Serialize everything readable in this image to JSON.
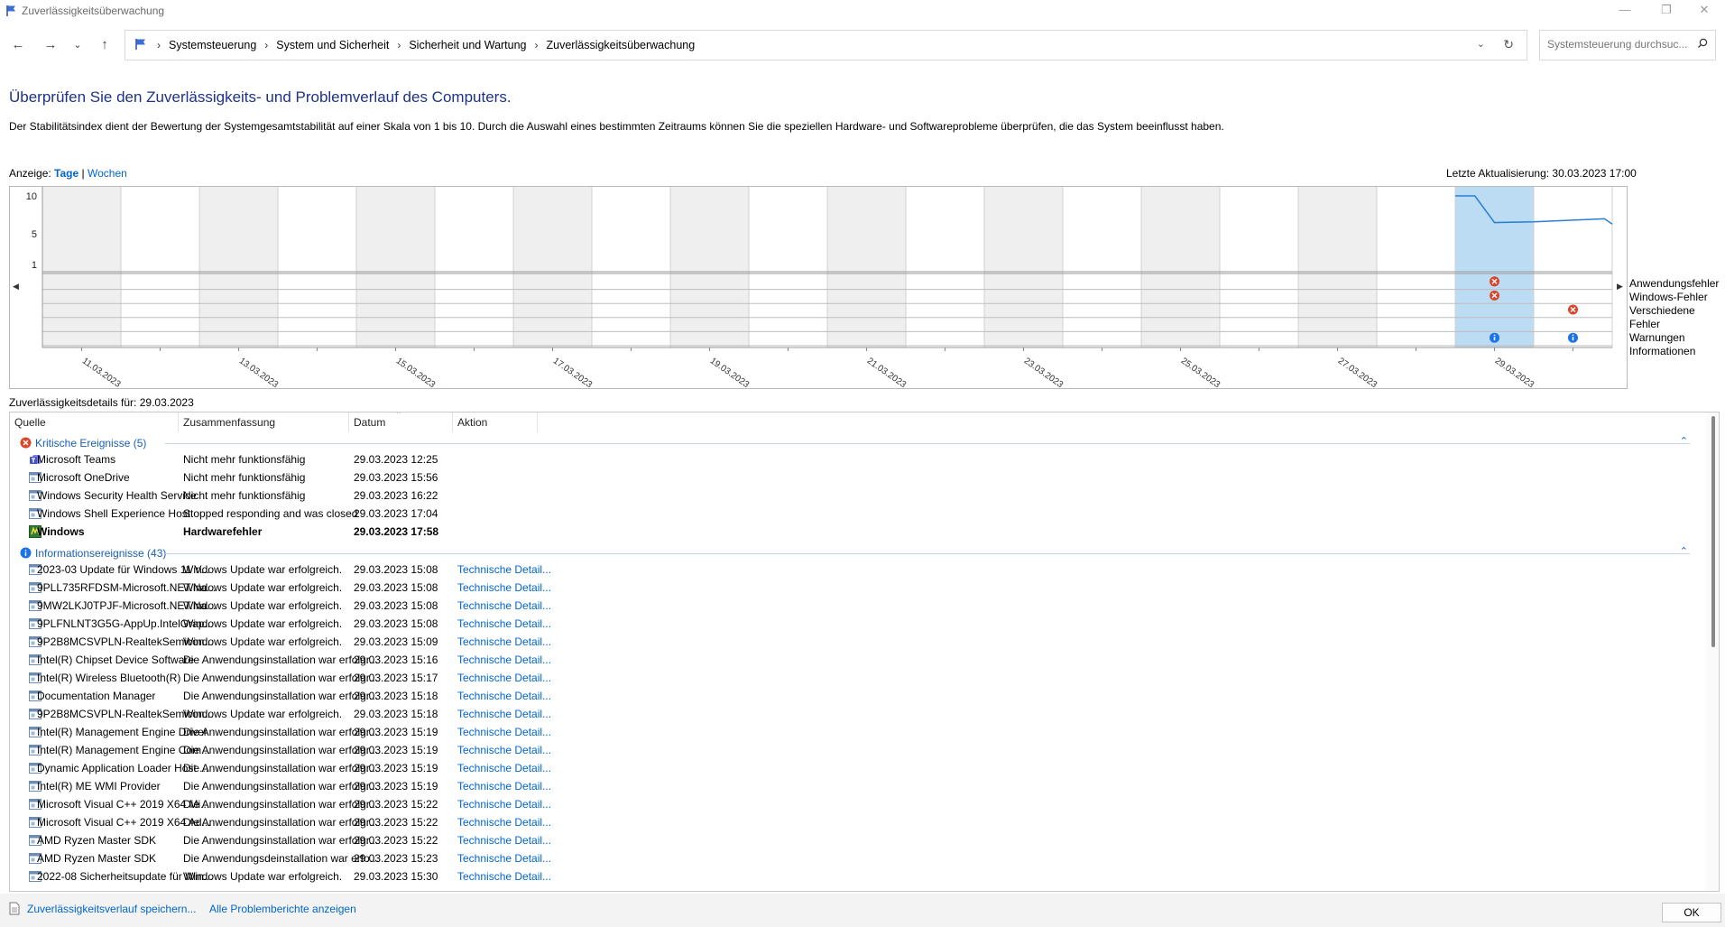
{
  "window": {
    "title": "Zuverlässigkeitsüberwachung"
  },
  "breadcrumbs": [
    "Systemsteuerung",
    "System und Sicherheit",
    "Sicherheit und Wartung",
    "Zuverlässigkeitsüberwachung"
  ],
  "search": {
    "placeholder": "Systemsteuerung durchsuc..."
  },
  "heading": "Überprüfen Sie den Zuverlässigkeits- und Problemverlauf des Computers.",
  "description": "Der Stabilitätsindex dient der Bewertung der Systemgesamtstabilität auf einer Skala von 1 bis 10. Durch die Auswahl eines bestimmten Zeitraums können Sie die speziellen Hardware- und Softwareprobleme überprüfen, die das System beeinflusst haben.",
  "view": {
    "label": "Anzeige:",
    "days": "Tage",
    "sep": "|",
    "weeks": "Wochen"
  },
  "last_update": "Letzte Aktualisierung: 30.03.2023 17:00",
  "chart_data": {
    "type": "line",
    "title": "",
    "yticks": [
      "10",
      "5",
      "1"
    ],
    "ylim": [
      1,
      10
    ],
    "x_labels": [
      "11.03.2023",
      "13.03.2023",
      "15.03.2023",
      "17.03.2023",
      "19.03.2023",
      "21.03.2023",
      "23.03.2023",
      "25.03.2023",
      "27.03.2023",
      "29.03.2023"
    ],
    "columns": 20,
    "selected_column": 18,
    "series": [
      {
        "points": [
          [
            18.0,
            10.0
          ],
          [
            18.25,
            10.0
          ],
          [
            18.5,
            6.5
          ],
          [
            19.0,
            6.6
          ],
          [
            19.9,
            7.0
          ],
          [
            20.0,
            6.3
          ]
        ]
      }
    ],
    "legend": [
      "Anwendungsfehler",
      "Windows-Fehler",
      "Verschiedene Fehler",
      "Warnungen",
      "Informationen"
    ],
    "events": [
      {
        "column": 18,
        "type": "Anwendungsfehler",
        "icon": "error"
      },
      {
        "column": 18,
        "type": "Windows-Fehler",
        "icon": "error"
      },
      {
        "column": 19,
        "type": "Verschiedene Fehler",
        "icon": "error"
      },
      {
        "column": 18,
        "type": "Informationen",
        "icon": "info"
      },
      {
        "column": 19,
        "type": "Informationen",
        "icon": "info"
      }
    ]
  },
  "details_label": "Zuverlässigkeitsdetails für: 29.03.2023",
  "columns": {
    "source": "Quelle",
    "summary": "Zusammenfassung",
    "date": "Datum",
    "action": "Aktion"
  },
  "groups": [
    {
      "title": "Kritische Ereignisse (5)",
      "icon": "error-icon",
      "rows": [
        {
          "source": "Microsoft Teams",
          "summary": "Nicht mehr funktionsfähig",
          "date": "29.03.2023 12:25",
          "action": "",
          "icon": "teams-icon"
        },
        {
          "source": "Microsoft OneDrive",
          "summary": "Nicht mehr funktionsfähig",
          "date": "29.03.2023 15:56",
          "action": "",
          "icon": "app-icon"
        },
        {
          "source": "Windows Security Health Service",
          "summary": "Nicht mehr funktionsfähig",
          "date": "29.03.2023 16:22",
          "action": "",
          "icon": "app-icon"
        },
        {
          "source": "Windows Shell Experience Host",
          "summary": "Stopped responding and was closed",
          "date": "29.03.2023 17:04",
          "action": "",
          "icon": "app-icon"
        },
        {
          "source": "Windows",
          "summary": "Hardwarefehler",
          "date": "29.03.2023 17:58",
          "action": "",
          "icon": "windows-icon",
          "bold": true
        }
      ]
    },
    {
      "title": "Informationsereignisse (43)",
      "icon": "info-icon",
      "rows": [
        {
          "source": "2023-03 Update für Windows 11 V...",
          "summary": "Windows Update war erfolgreich.",
          "date": "29.03.2023 15:08",
          "action": "Technische Detail..."
        },
        {
          "source": "9PLL735RFDSM-Microsoft.NET.Na...",
          "summary": "Windows Update war erfolgreich.",
          "date": "29.03.2023 15:08",
          "action": "Technische Detail..."
        },
        {
          "source": "9MW2LKJ0TPJF-Microsoft.NET.Na...",
          "summary": "Windows Update war erfolgreich.",
          "date": "29.03.2023 15:08",
          "action": "Technische Detail..."
        },
        {
          "source": "9PLFNLNT3G5G-AppUp.IntelGrap...",
          "summary": "Windows Update war erfolgreich.",
          "date": "29.03.2023 15:08",
          "action": "Technische Detail..."
        },
        {
          "source": "9P2B8MCSVPLN-RealtekSemicon...",
          "summary": "Windows Update war erfolgreich.",
          "date": "29.03.2023 15:09",
          "action": "Technische Detail..."
        },
        {
          "source": "Intel(R) Chipset Device Software",
          "summary": "Die Anwendungsinstallation war erfolgr...",
          "date": "29.03.2023 15:16",
          "action": "Technische Detail..."
        },
        {
          "source": "Intel(R) Wireless Bluetooth(R)",
          "summary": "Die Anwendungsinstallation war erfolgr...",
          "date": "29.03.2023 15:17",
          "action": "Technische Detail..."
        },
        {
          "source": "Documentation Manager",
          "summary": "Die Anwendungsinstallation war erfolgr...",
          "date": "29.03.2023 15:18",
          "action": "Technische Detail..."
        },
        {
          "source": "9P2B8MCSVPLN-RealtekSemicon...",
          "summary": "Windows Update war erfolgreich.",
          "date": "29.03.2023 15:18",
          "action": "Technische Detail..."
        },
        {
          "source": "Intel(R) Management Engine Driver",
          "summary": "Die Anwendungsinstallation war erfolgr...",
          "date": "29.03.2023 15:19",
          "action": "Technische Detail..."
        },
        {
          "source": "Intel(R) Management Engine Com...",
          "summary": "Die Anwendungsinstallation war erfolgr...",
          "date": "29.03.2023 15:19",
          "action": "Technische Detail..."
        },
        {
          "source": "Dynamic Application Loader Host ...",
          "summary": "Die Anwendungsinstallation war erfolgr...",
          "date": "29.03.2023 15:19",
          "action": "Technische Detail..."
        },
        {
          "source": "Intel(R) ME WMI Provider",
          "summary": "Die Anwendungsinstallation war erfolgr...",
          "date": "29.03.2023 15:19",
          "action": "Technische Detail..."
        },
        {
          "source": "Microsoft Visual C++ 2019 X64 Mi...",
          "summary": "Die Anwendungsinstallation war erfolgr...",
          "date": "29.03.2023 15:22",
          "action": "Technische Detail..."
        },
        {
          "source": "Microsoft Visual C++ 2019 X64 Ad...",
          "summary": "Die Anwendungsinstallation war erfolgr...",
          "date": "29.03.2023 15:22",
          "action": "Technische Detail..."
        },
        {
          "source": "AMD Ryzen Master SDK",
          "summary": "Die Anwendungsinstallation war erfolgr...",
          "date": "29.03.2023 15:22",
          "action": "Technische Detail..."
        },
        {
          "source": "AMD Ryzen Master SDK",
          "summary": "Die Anwendungsdeinstallation war erfo...",
          "date": "29.03.2023 15:23",
          "action": "Technische Detail..."
        },
        {
          "source": "2022-08 Sicherheitsupdate für Win...",
          "summary": "Windows Update war erfolgreich.",
          "date": "29.03.2023 15:30",
          "action": "Technische Detail..."
        }
      ]
    }
  ],
  "footer": {
    "save": "Zuverlässigkeitsverlauf speichern...",
    "all_reports": "Alle Problemberichte anzeigen",
    "ok": "OK"
  },
  "colors": {
    "heading": "#1e3287",
    "link": "#0066cc",
    "selected": "#bcdcf4",
    "shade": "#efefef",
    "line": "#2a7fd4",
    "error": "#d9462a",
    "info": "#1a73e8"
  }
}
